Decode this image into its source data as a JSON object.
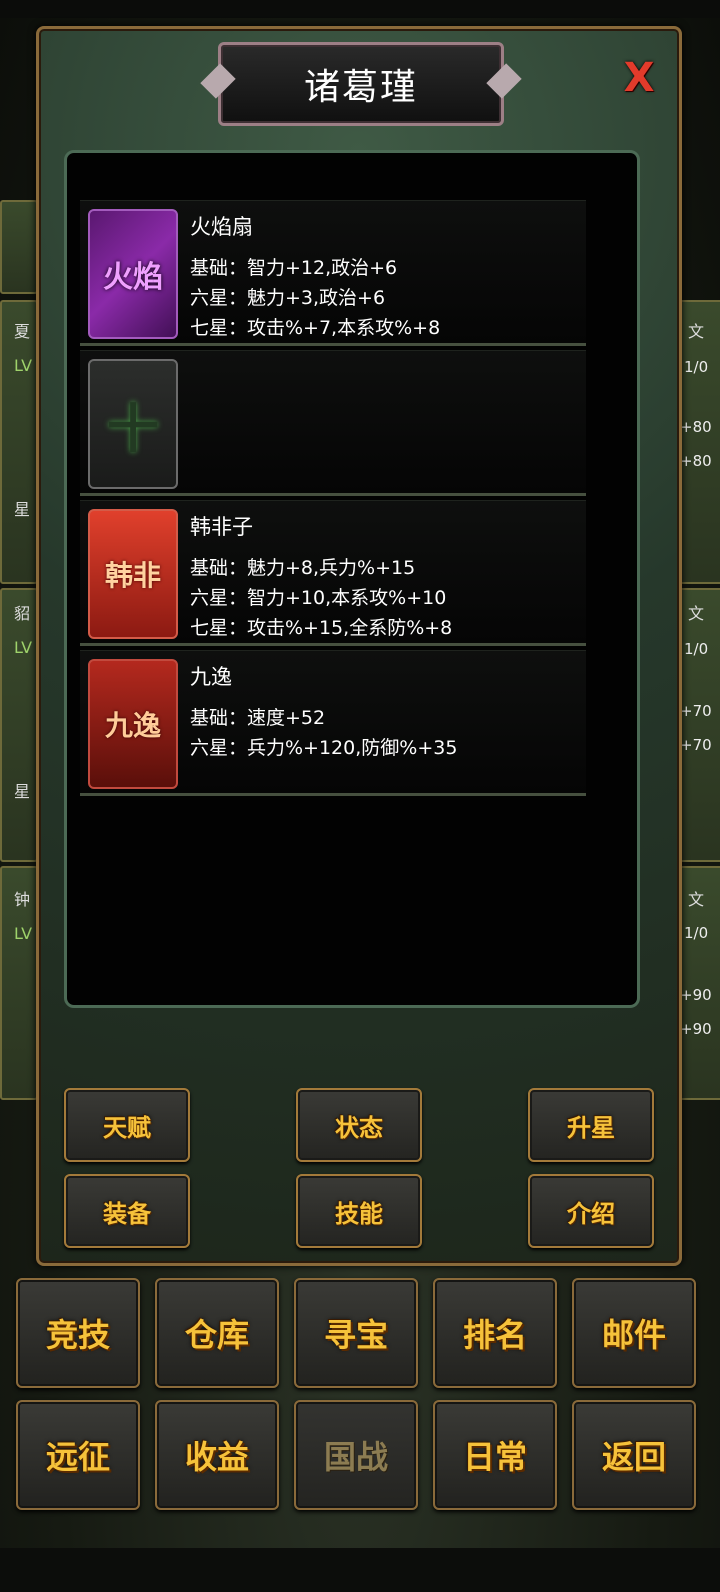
{
  "modal": {
    "title": "诸葛瑾",
    "close_label": "X"
  },
  "items": [
    {
      "name": "火焰扇",
      "icon_text": "火焰",
      "icon": "flame-fan-icon",
      "lines": [
        "基础：智力+12,政治+6",
        "六星：魅力+3,政治+6",
        "七星：攻击%+7,本系攻%+8"
      ]
    },
    {
      "name": "",
      "icon_text": "十",
      "icon": "empty-slot-icon",
      "lines": []
    },
    {
      "name": "韩非子",
      "icon_text": "韩非",
      "icon": "book-icon",
      "lines": [
        "基础：魅力+8,兵力%+15",
        "六星：智力+10,本系攻%+10",
        "七星：攻击%+15,全系防%+8"
      ]
    },
    {
      "name": "九逸",
      "icon_text": "九逸",
      "icon": "horse-icon",
      "lines": [
        "基础：速度+52",
        "六星：兵力%+120,防御%+35"
      ]
    }
  ],
  "modal_buttons": [
    "天赋",
    "状态",
    "升星",
    "装备",
    "技能",
    "介绍"
  ],
  "nav_row1": [
    "竞技",
    "仓库",
    "寻宝",
    "排名",
    "邮件"
  ],
  "nav_row2": [
    "远征",
    "收益",
    "国战",
    "日常",
    "返回"
  ],
  "background_list": {
    "names": [
      "夏",
      "貂",
      "钟"
    ],
    "lv": "LV",
    "star": "星",
    "wen": "文",
    "ratio": "1/0",
    "bonuses": [
      "+80",
      "+80",
      "+70",
      "+70",
      "+90",
      "+90"
    ]
  },
  "colors": {
    "gold_text": "#f6c23a",
    "close_red": "#e23b2b",
    "panel_green": "#26382b"
  }
}
